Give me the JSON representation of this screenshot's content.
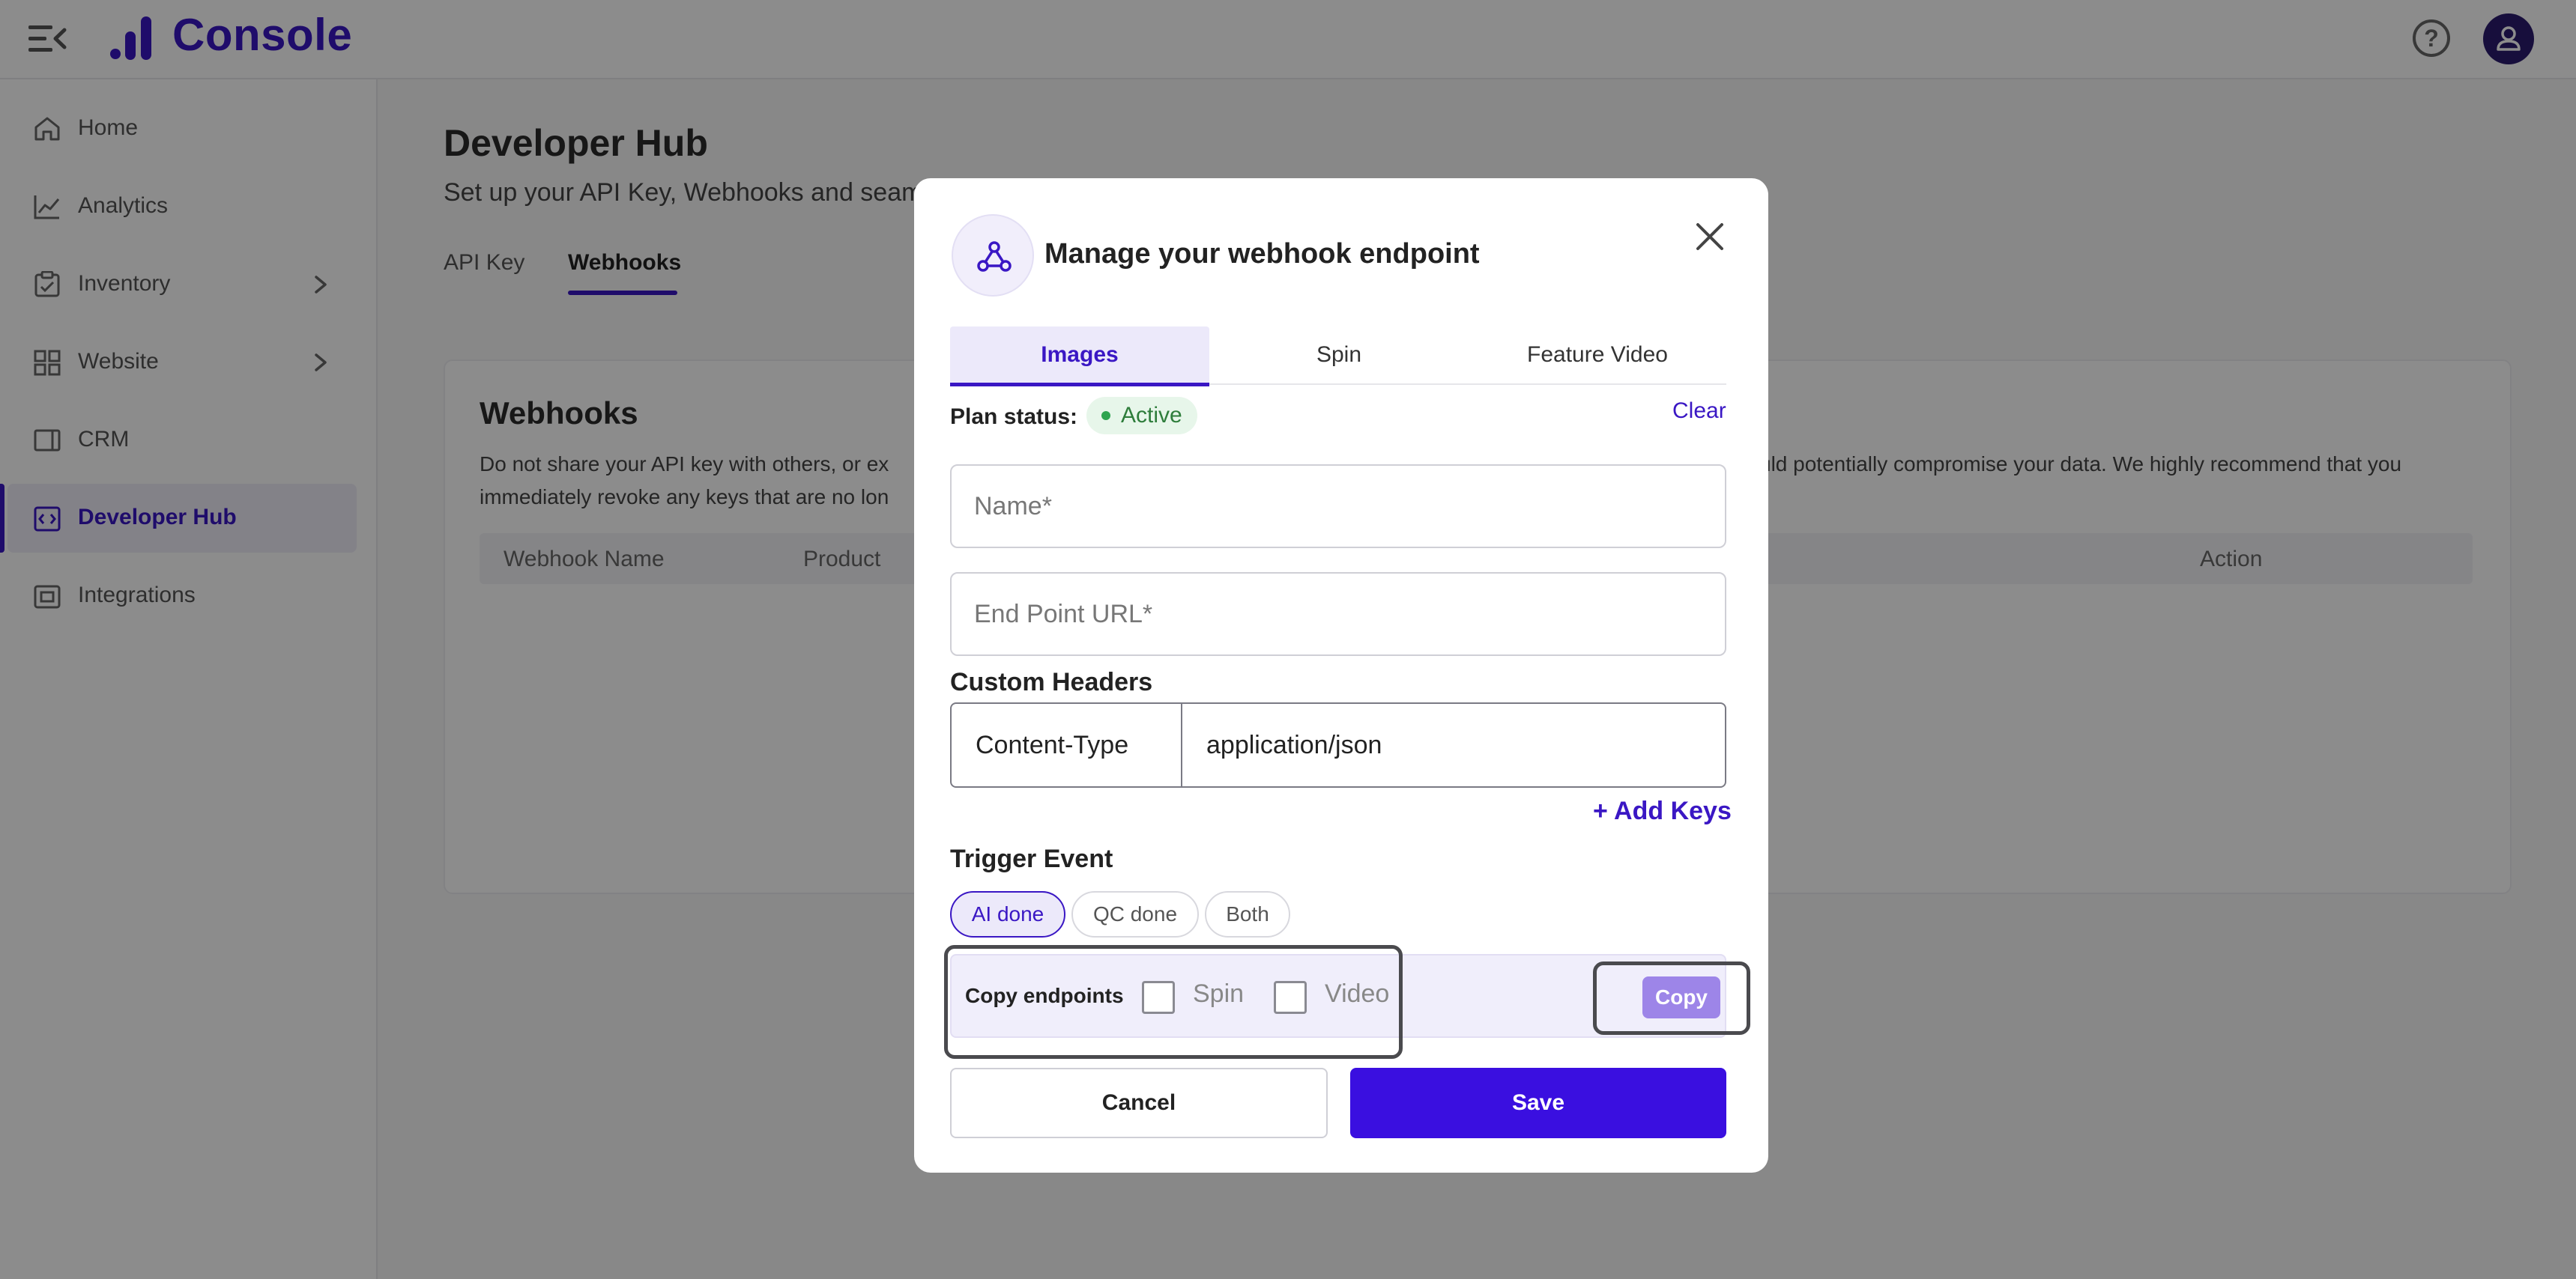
{
  "app": {
    "title": "Console"
  },
  "topbar": {
    "menu_icon": "menu-collapse-icon",
    "help_icon": "help-icon",
    "help_glyph": "?",
    "avatar_icon": "user-icon"
  },
  "sidebar": {
    "items": [
      {
        "label": "Home",
        "icon": "home-icon"
      },
      {
        "label": "Analytics",
        "icon": "analytics-icon"
      },
      {
        "label": "Inventory",
        "icon": "inventory-icon"
      },
      {
        "label": "Website",
        "icon": "website-icon"
      },
      {
        "label": "CRM",
        "icon": "crm-icon"
      },
      {
        "label": "Developer Hub",
        "icon": "developer-hub-icon"
      },
      {
        "label": "Integrations",
        "icon": "integrations-icon"
      }
    ]
  },
  "main": {
    "title": "Developer Hub",
    "subtitle": "Set up your API Key, Webhooks and seam",
    "tabs": [
      {
        "label": "API Key"
      },
      {
        "label": "Webhooks"
      }
    ],
    "card": {
      "title": "Webhooks",
      "text_left_1": "Do not share your API key with others, or ex",
      "text_right_1": "uld potentially compromise your data. We highly recommend that you",
      "text_left_2": "immediately revoke any keys that are no lon",
      "columns": [
        "Webhook Name",
        "Product",
        "Action"
      ]
    }
  },
  "modal": {
    "title": "Manage your webhook endpoint",
    "icon": "webhook-icon",
    "tabs": [
      {
        "label": "Images"
      },
      {
        "label": "Spin"
      },
      {
        "label": "Feature Video"
      }
    ],
    "plan_status_label": "Plan status:",
    "plan_status_value": "Active",
    "clear_label": "Clear",
    "name_placeholder": "Name*",
    "endpoint_placeholder": "End Point URL*",
    "custom_headers_label": "Custom Headers",
    "header_key": "Content-Type",
    "header_value": "application/json",
    "add_keys_label": "+ Add Keys",
    "trigger_event_label": "Trigger Event",
    "trigger_options": [
      {
        "label": "AI done"
      },
      {
        "label": "QC done"
      },
      {
        "label": "Both"
      }
    ],
    "copy_endpoints_label": "Copy endpoints",
    "copy_options": [
      {
        "label": "Spin"
      },
      {
        "label": "Video"
      }
    ],
    "copy_button_label": "Copy",
    "cancel_label": "Cancel",
    "save_label": "Save"
  },
  "colors": {
    "brand": "#3a17c4",
    "primary_button": "#3a0fe0",
    "active_status": "#2e7d3b",
    "copy_button": "#9d85e8"
  }
}
